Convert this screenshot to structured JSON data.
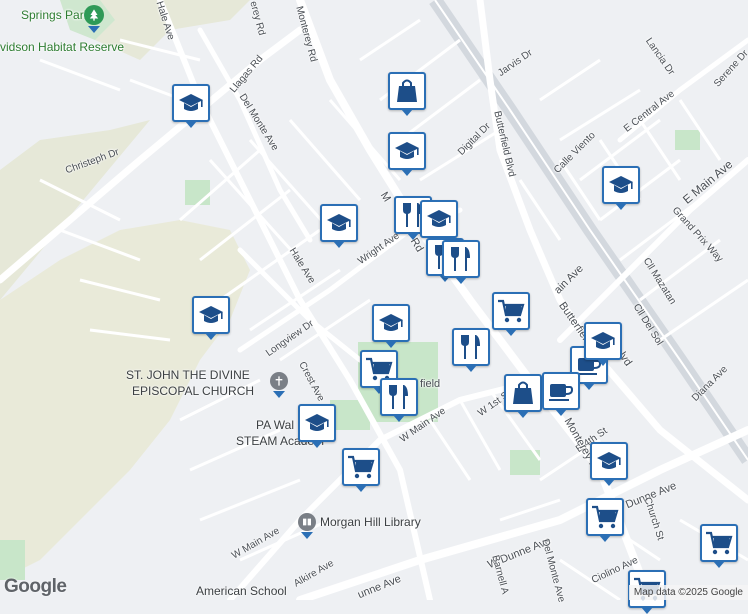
{
  "map": {
    "labels": {
      "springs_park": "Springs Park",
      "habitat_reserve": "vidson Habitat Reserve",
      "hale_ave_top": "Hale Ave",
      "monterey_rd_top": "Monterey Rd",
      "erey_rd": "erey Rd",
      "llagas_rd": "Llagas Rd",
      "del_monte_ave_top": "Del Monte Ave",
      "christeph_dr": "Christeph Dr",
      "jarvis_dr": "Jarvis Dr",
      "digital_dr": "Digital Dr",
      "butterfield_blvd": "Butterfield Blvd",
      "lancia_dr": "Lancia Dr",
      "serene_dr": "Serene Dr",
      "e_central_ave": "E Central Ave",
      "calle_viento": "Calle Viento",
      "e_main_ave": "E Main Ave",
      "grand_prix_way": "Grand Prix Way",
      "wright_ave": "Wright Ave",
      "hale_ave_mid": "Hale Ave",
      "monterey_mid": "M",
      "monterey_mid_rd": "Rd",
      "cll_mazatan": "Cll Mazatan",
      "cll_del_sol": "Cll Del Sol",
      "butterfield_lower": "Butterfiel",
      "butterfield_blvd_suffix": "lvd",
      "longview_dr": "Longview Dr",
      "crest_ave": "Crest Ave",
      "main_ave_partial": "ain Ave",
      "diana_ave": "Diana Ave",
      "field_partial": "field",
      "w_1st_st": "W 1st S",
      "w_main_ave_mid": "W Main Ave",
      "e_4th_st": "E 4th St",
      "e_partial": "E",
      "monterey_rd_lower": "Monterey R",
      "dunne_ave_e": "Dunne Ave",
      "church_st": "Church St",
      "w_main_ave_low": "W Main Ave",
      "w_dunne_ave": "W Dunne Ave",
      "del_monte_ave_low": "Del Monte Ave",
      "barnell_ave": "Barnell A",
      "ciolino_ave": "Ciolino Ave",
      "alkire_ave": "Alkire Ave",
      "dunne_ave_low": "unne Ave"
    },
    "pois": {
      "st_john": "ST. JOHN THE DIVINE",
      "episcopal": "EPISCOPAL CHURCH",
      "pa_walsh": "PA Wal",
      "steam": "STEAM Academ",
      "library": "Morgan Hill Library",
      "american_school": "American School"
    },
    "markers": [
      {
        "icon": "school-icon",
        "label": "school"
      },
      {
        "icon": "shopping-bag-icon",
        "label": "shopping"
      },
      {
        "icon": "school-icon",
        "label": "school"
      },
      {
        "icon": "school-icon",
        "label": "school"
      },
      {
        "icon": "restaurant-icon",
        "label": "restaurant"
      },
      {
        "icon": "school-icon",
        "label": "school"
      },
      {
        "icon": "restaurant-icon",
        "label": "restaurant"
      },
      {
        "icon": "restaurant-icon",
        "label": "restaurant"
      },
      {
        "icon": "school-icon",
        "label": "school"
      },
      {
        "icon": "school-icon",
        "label": "school"
      },
      {
        "icon": "school-icon",
        "label": "school"
      },
      {
        "icon": "shopping-cart-icon",
        "label": "grocery"
      },
      {
        "icon": "restaurant-icon",
        "label": "restaurant"
      },
      {
        "icon": "cafe-icon",
        "label": "cafe"
      },
      {
        "icon": "school-icon",
        "label": "school"
      },
      {
        "icon": "shopping-cart-icon",
        "label": "grocery"
      },
      {
        "icon": "restaurant-icon",
        "label": "restaurant"
      },
      {
        "icon": "shopping-bag-icon",
        "label": "shopping"
      },
      {
        "icon": "cafe-icon",
        "label": "cafe"
      },
      {
        "icon": "school-icon",
        "label": "school"
      },
      {
        "icon": "shopping-cart-icon",
        "label": "grocery"
      },
      {
        "icon": "school-icon",
        "label": "school"
      },
      {
        "icon": "shopping-cart-icon",
        "label": "grocery"
      },
      {
        "icon": "shopping-cart-icon",
        "label": "grocery"
      },
      {
        "icon": "shopping-cart-icon",
        "label": "grocery"
      }
    ],
    "colors": {
      "background": "#eef0f3",
      "park": "#c8e6c9",
      "road": "#ffffff",
      "highway": "#d5dae0",
      "terrain": "#e9ead9",
      "marker_border": "#2b6fb5",
      "marker_icon": "#1d4e89"
    },
    "google_logo": "Google",
    "attribution": "Map data ©2025 Google"
  }
}
